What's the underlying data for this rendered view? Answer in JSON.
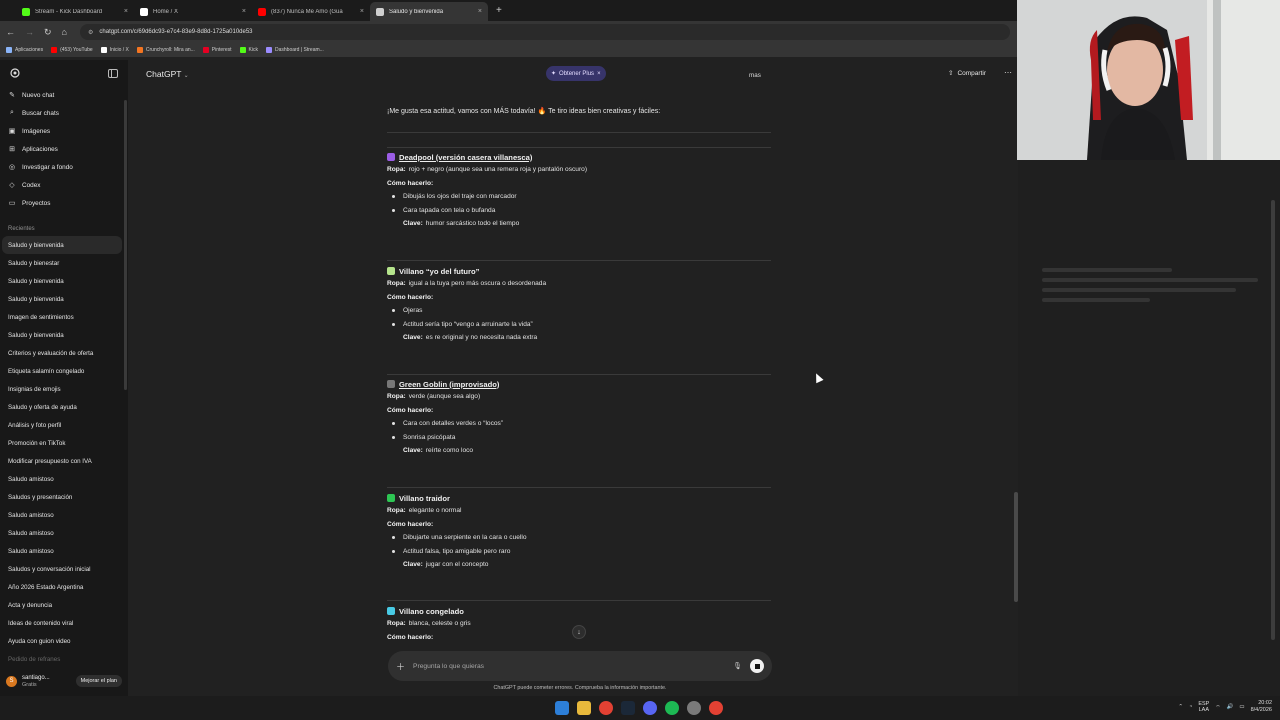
{
  "browser": {
    "tabs": [
      {
        "title": "Stream - Kick Dashboard",
        "color": "#53fc18",
        "active": false
      },
      {
        "title": "Home / X",
        "color": "#ffffff",
        "active": false
      },
      {
        "title": "(837) Nunca Me Amo (Gua",
        "color": "#ff0000",
        "active": false
      },
      {
        "title": "Saludo y bienvenida",
        "color": "#cfcfcf",
        "active": true
      }
    ],
    "url": "chatgpt.com/c/69d6dc93-e7c4-83e9-8d8d-1725a010de53",
    "bookmarks": [
      {
        "label": "Aplicaciones",
        "color": "#8ab4f8"
      },
      {
        "label": "(453) YouTube",
        "color": "#ff0000"
      },
      {
        "label": "Inicio / X",
        "color": "#ffffff"
      },
      {
        "label": "Crunchyroll: Mira an...",
        "color": "#f47521"
      },
      {
        "label": "Pinterest",
        "color": "#e60023"
      },
      {
        "label": "Kick",
        "color": "#53fc18"
      },
      {
        "label": "Dashboard | Stream...",
        "color": "#9b8cff"
      }
    ]
  },
  "sidebar": {
    "nav": [
      {
        "label": "Nuevo chat",
        "icon": "new-chat-icon",
        "glyph": "✎"
      },
      {
        "label": "Buscar chats",
        "icon": "search-icon",
        "glyph": "⌕"
      },
      {
        "label": "Imágenes",
        "icon": "image-icon",
        "glyph": "▣"
      },
      {
        "label": "Aplicaciones",
        "icon": "apps-icon",
        "glyph": "⊞"
      },
      {
        "label": "Investigar a fondo",
        "icon": "research-icon",
        "glyph": "◎"
      },
      {
        "label": "Codex",
        "icon": "codex-icon",
        "glyph": "◇"
      },
      {
        "label": "Proyectos",
        "icon": "folder-icon",
        "glyph": "▭"
      }
    ],
    "recent_label": "Recientes",
    "chats": [
      "Saludo y bienvenida",
      "Saludo y bienestar",
      "Saludo y bienvenida",
      "Saludo y bienvenida",
      "Imagen de sentimientos",
      "Saludo y bienvenida",
      "Criterios y evaluación de oferta",
      "Etiqueta salamín congelado",
      "Insignias de emojis",
      "Saludo y oferta de ayuda",
      "Análisis y foto perfil",
      "Promoción en TikTok",
      "Modificar presupuesto con IVA",
      "Saludo amistoso",
      "Saludos y presentación",
      "Saludo amistoso",
      "Saludo amistoso",
      "Saludo amistoso",
      "Saludos y conversación inicial",
      "Año 2026 Estado Argentina",
      "Acta y denuncia",
      "Ideas de contenido viral",
      "Ayuda con guion video",
      "Pedido de refranes"
    ],
    "user": {
      "name": "santiago...",
      "plan": "Gratis",
      "initial": "S",
      "upgrade": "Mejorar el plan"
    }
  },
  "header": {
    "model": "ChatGPT",
    "plus": "Obtener Plus",
    "mas": "mas",
    "share": "Compartir"
  },
  "message": {
    "intro": "¡Me gusta esa actitud, vamos con MÁS todavía! 🔥 Te tiro ideas bien creativas y fáciles:",
    "sections": [
      {
        "title": "Deadpool (versión casera villanesca)",
        "emoji_color": "#9b5de5",
        "ropa": "rojo + negro (aunque sea una remera roja y pantalón oscuro)",
        "items": [
          "Dibujás los ojos del traje con marcador",
          "Cara tapada con tela o bufanda"
        ],
        "clave": "humor sarcástico todo el tiempo"
      },
      {
        "title": "Villano “yo del futuro”",
        "emoji_color": "#b5e48c",
        "ropa": "igual a la tuya pero más oscura o desordenada",
        "items": [
          "Ojeras",
          "Actitud sería tipo “vengo a arruinarte la vida”"
        ],
        "clave": "es re original y no necesita nada extra"
      },
      {
        "title": "Green Goblin (improvisado)",
        "emoji_color": "#777777",
        "ropa": "verde (aunque sea algo)",
        "items": [
          "Cara con detalles verdes o “locos”",
          "Sonrisa psicópata"
        ],
        "clave": "reírte como loco"
      },
      {
        "title": "Villano traidor",
        "emoji_color": "#2dc653",
        "ropa": "elegante o normal",
        "items": [
          "Dibujarte una serpiente en la cara o cuello",
          "Actitud falsa, tipo amigable pero raro"
        ],
        "clave": "jugar con el concepto"
      },
      {
        "title": "Villano congelado",
        "emoji_color": "#48cae4",
        "ropa": "blanca, celeste o gris",
        "items": [],
        "clave": ""
      }
    ],
    "labels": {
      "ropa": "Ropa:",
      "como": "Cómo hacerlo:",
      "clave": "Clave:"
    }
  },
  "composer": {
    "placeholder": "Pregunta lo que quieras",
    "disclaimer": "ChatGPT puede cometer errores. Comprueba la información importante."
  },
  "taskbar": {
    "lang": "ESP",
    "lang2": "LAA",
    "time": "20:02",
    "date": "8/4/2026"
  }
}
